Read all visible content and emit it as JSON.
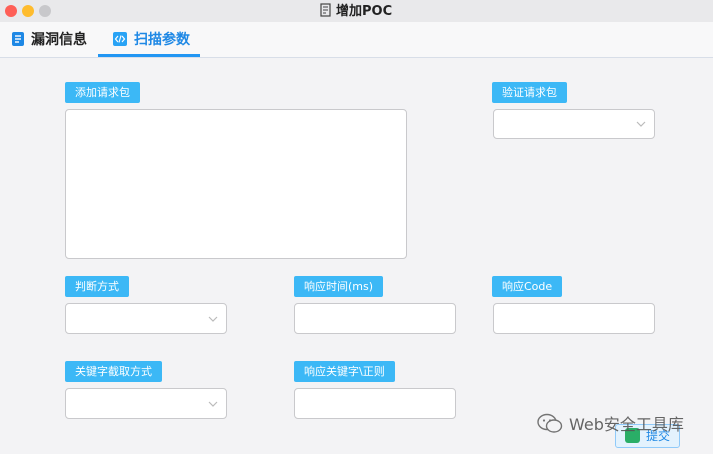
{
  "window": {
    "title": "增加POC"
  },
  "tabs": [
    {
      "label": "漏洞信息",
      "icon": "document-icon"
    },
    {
      "label": "扫描参数",
      "icon": "code-icon",
      "active": true
    }
  ],
  "form": {
    "add_request_label": "添加请求包",
    "verify_request_label": "验证请求包",
    "judge_method_label": "判断方式",
    "response_time_label": "响应时间(ms)",
    "response_code_label": "响应Code",
    "keyword_extract_label": "关键字截取方式",
    "response_keyword_label": "响应关键字\\正则",
    "verify_request_value": "",
    "judge_method_value": "",
    "keyword_extract_value": "",
    "response_time_value": "",
    "response_code_value": "",
    "response_keyword_value": "",
    "add_request_value": ""
  },
  "submit_label": "提交",
  "watermark": {
    "text": "Web安全工具库"
  },
  "colors": {
    "accent": "#2196f3",
    "label_bg": "#3cb8f6"
  }
}
